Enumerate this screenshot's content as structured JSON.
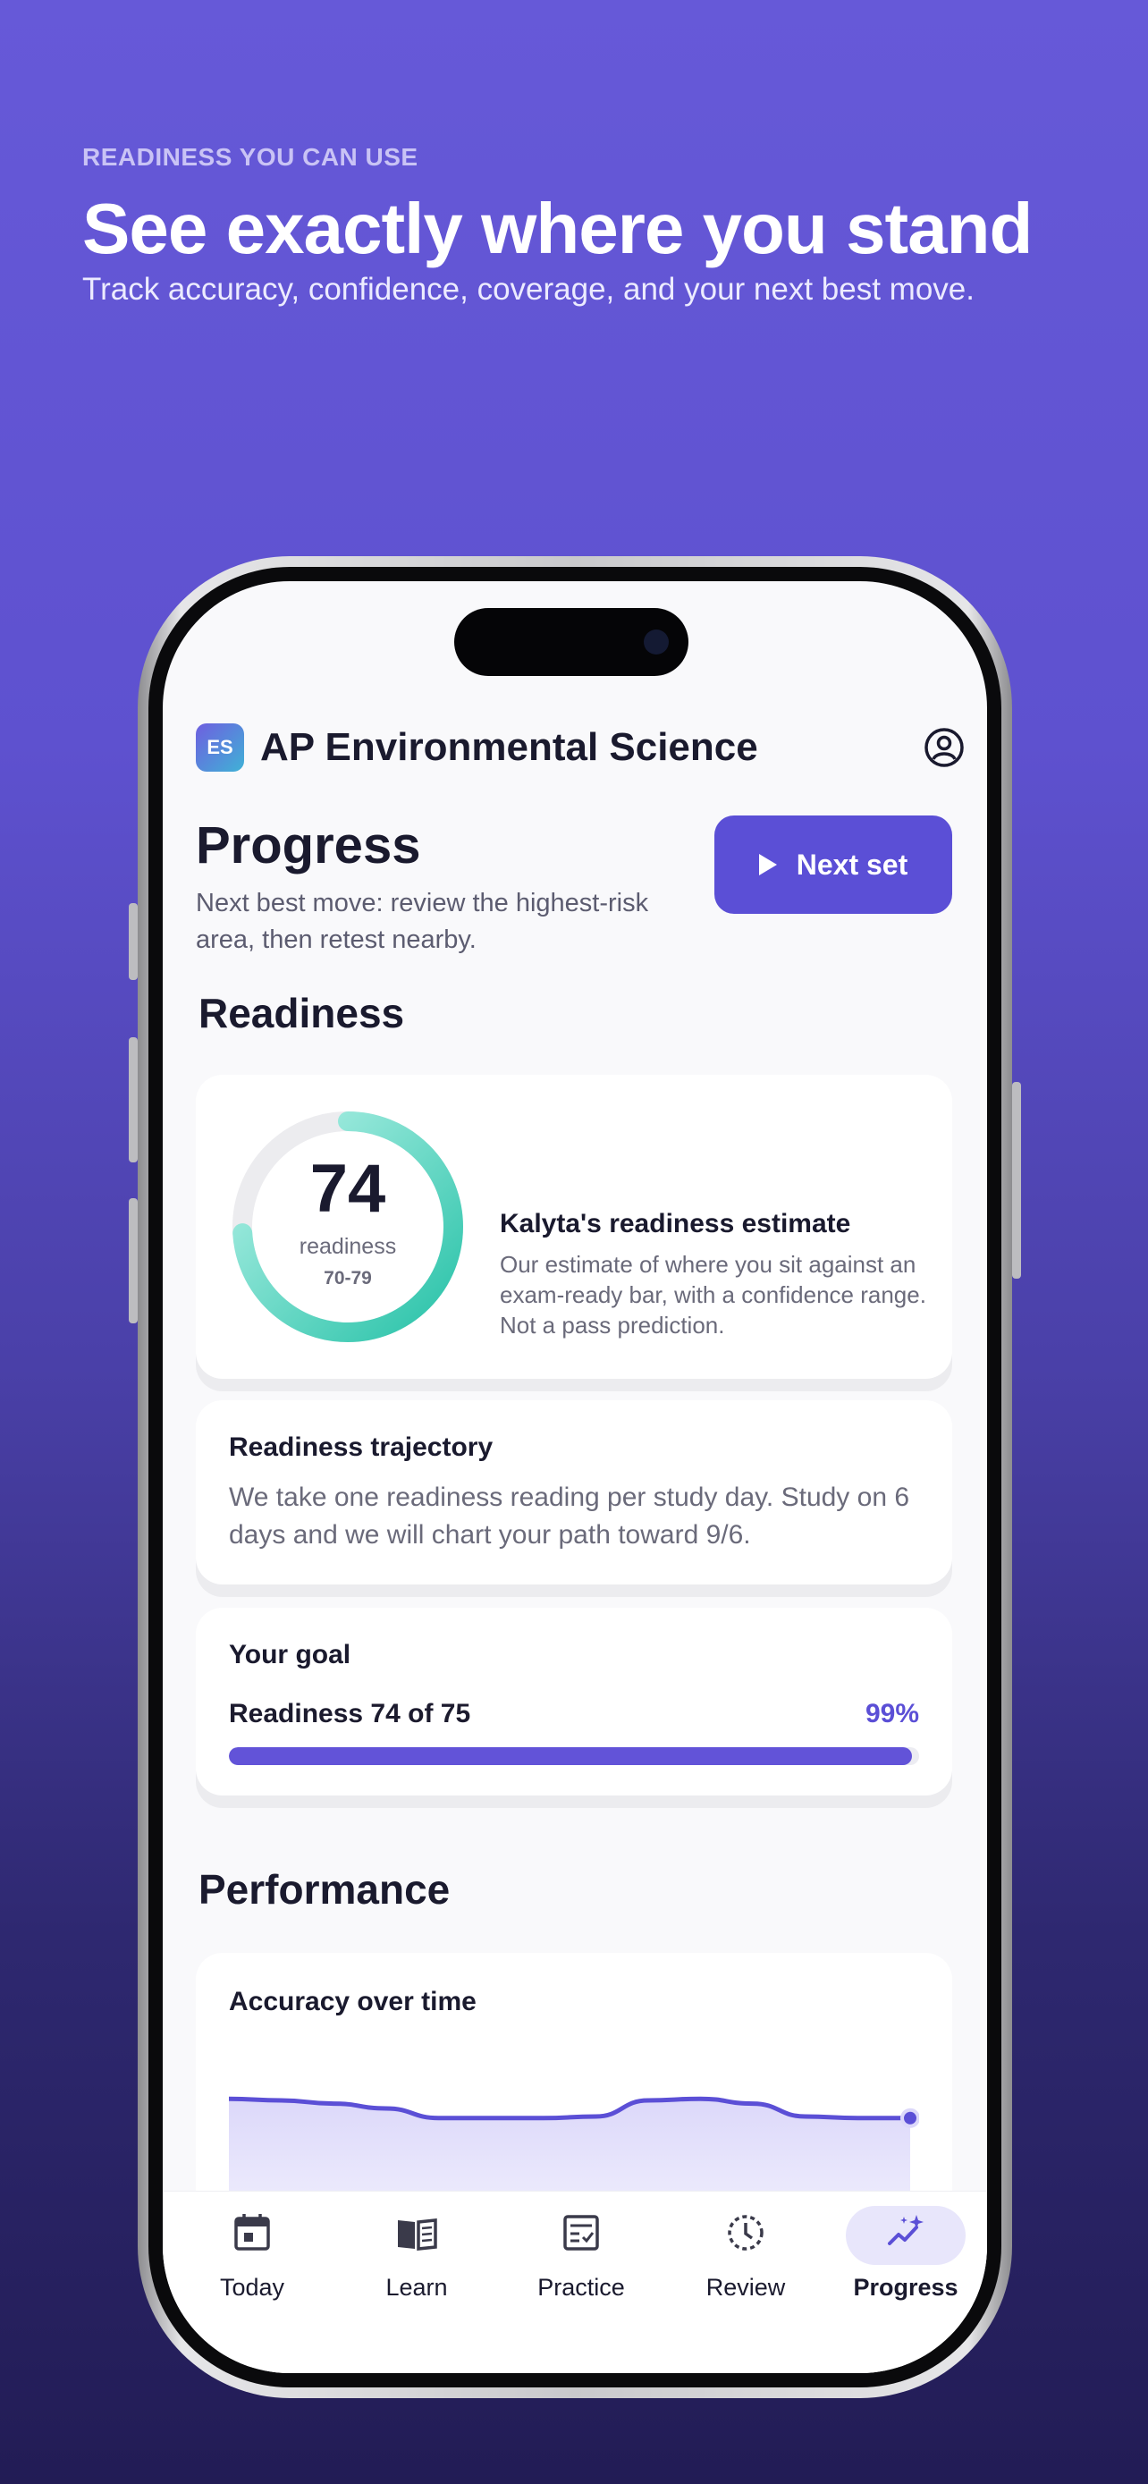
{
  "hero": {
    "eyebrow": "READINESS YOU CAN USE",
    "headline": "See exactly where you stand",
    "subline": "Track accuracy, confidence, coverage, and your next best move."
  },
  "app": {
    "badge": "ES",
    "title": "AP Environmental Science",
    "profile_icon": "user-circle-icon"
  },
  "page": {
    "title": "Progress",
    "subtitle": "Next best move: review the highest-risk area, then retest nearby.",
    "next_button": "Next set"
  },
  "readiness": {
    "section_title": "Readiness",
    "score": "74",
    "score_label": "readiness",
    "range": "70-79",
    "score_fraction": 0.74,
    "estimate_title": "Kalyta's readiness estimate",
    "estimate_body": "Our estimate of where you sit against an exam-ready bar, with a confidence range. Not a pass prediction."
  },
  "trajectory": {
    "title": "Readiness trajectory",
    "body": "We take one readiness reading per study day. Study on 6 days and we will chart your path toward 9/6."
  },
  "goal": {
    "title": "Your goal",
    "label": "Readiness 74 of 75",
    "percent": "99%",
    "progress_fraction": 0.99
  },
  "performance": {
    "section_title": "Performance",
    "accuracy_title": "Accuracy over time",
    "accuracy_points": [
      0.76,
      0.75,
      0.73,
      0.7,
      0.64,
      0.64,
      0.64,
      0.65,
      0.75,
      0.76,
      0.73,
      0.65,
      0.64,
      0.64
    ]
  },
  "tabs": [
    {
      "label": "Today",
      "icon": "calendar-icon"
    },
    {
      "label": "Learn",
      "icon": "book-icon"
    },
    {
      "label": "Practice",
      "icon": "checklist-icon"
    },
    {
      "label": "Review",
      "icon": "clock-icon"
    },
    {
      "label": "Progress",
      "icon": "trend-sparkle-icon",
      "active": true
    }
  ],
  "colors": {
    "accent": "#5b4fd6",
    "ring_teal": "#2ec7b0",
    "ring_mint": "#a9f0e4"
  }
}
